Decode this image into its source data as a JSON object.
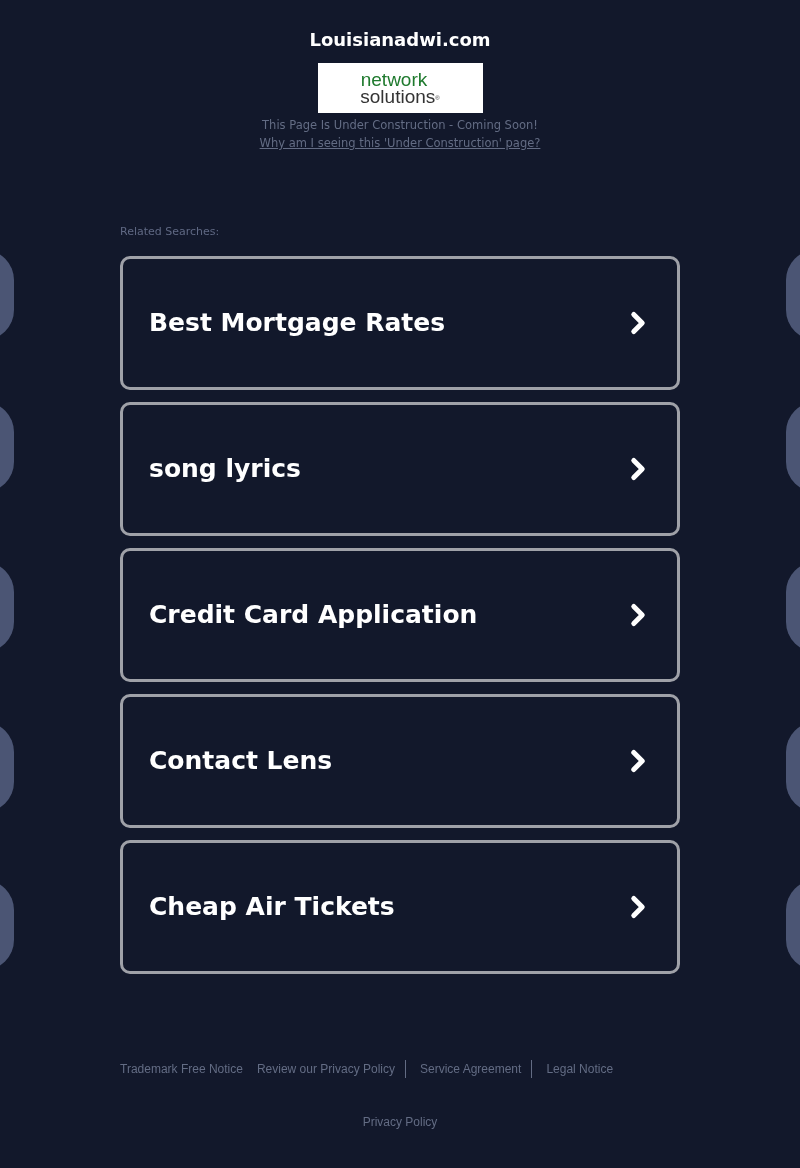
{
  "site_title": "Louisianadwi.com",
  "logo": {
    "line_1": "network",
    "line_2": "solutions",
    "mark": "®"
  },
  "notice": "This Page Is Under Construction - Coming Soon!",
  "notice_link": "Why am I seeing this 'Under Construction' page?",
  "related_label": "Related Searches:",
  "searches": [
    {
      "label": "Best Mortgage Rates"
    },
    {
      "label": "song lyrics"
    },
    {
      "label": "Credit Card Application"
    },
    {
      "label": "Contact Lens"
    },
    {
      "label": "Cheap Air Tickets"
    }
  ],
  "footer_links": [
    {
      "label": "Trademark Free Notice",
      "divider": false
    },
    {
      "label": "Review our Privacy Policy",
      "divider": true
    },
    {
      "label": "Service Agreement",
      "divider": true
    },
    {
      "label": "Legal Notice",
      "divider": false
    }
  ],
  "privacy_link": "Privacy Policy"
}
